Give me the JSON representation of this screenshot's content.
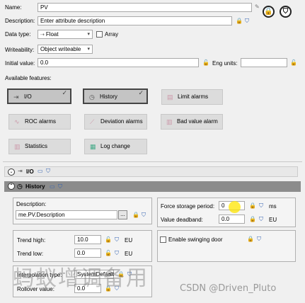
{
  "name": {
    "label": "Name:",
    "value": "PV"
  },
  "description": {
    "label": "Description:",
    "placeholder": "Enter attribute description"
  },
  "data_type": {
    "label": "Data type:",
    "value": "Float",
    "array_label": "Array"
  },
  "writeability": {
    "label": "Writeability:",
    "value": "Object writeable"
  },
  "initial_value": {
    "label": "Initial value:",
    "value": "0.0"
  },
  "eng_units": {
    "label": "Eng units:",
    "value": ""
  },
  "available_features": {
    "label": "Available features:"
  },
  "features": {
    "io": "I/O",
    "history": "History",
    "limit_alarms": "Limit alarms",
    "roc_alarms": "ROC alarms",
    "deviation_alarms": "Deviation alarms",
    "bad_value_alarm": "Bad value alarm",
    "statistics": "Statistics",
    "log_change": "Log change"
  },
  "sections": {
    "io": "I/O",
    "history": "History"
  },
  "history": {
    "description_label": "Description:",
    "description_value": "me.PV.Description",
    "ellipsis": "...",
    "force_storage_label": "Force storage period:",
    "force_storage_value": "0",
    "force_storage_unit": "ms",
    "value_deadband_label": "Value deadband:",
    "value_deadband_value": "0.0",
    "value_deadband_unit": "EU",
    "trend_high_label": "Trend high:",
    "trend_high_value": "10.0",
    "trend_high_unit": "EU",
    "trend_low_label": "Trend low:",
    "trend_low_value": "0.0",
    "trend_low_unit": "EU",
    "swinging_door_label": "Enable swinging door",
    "interpolation_label": "Interpolation type:",
    "interpolation_value": "SystemDefault",
    "rollover_label": "Rollover value:",
    "rollover_value": "0.0"
  },
  "watermark": "CSDN @Driven_Pluto",
  "watermark_cjk": "蚂蚁增调备用",
  "icons": {
    "lock": "lock-icon",
    "shield": "shield-icon",
    "padlock_round": "round-lock-button",
    "shield_round": "round-shield-button"
  }
}
